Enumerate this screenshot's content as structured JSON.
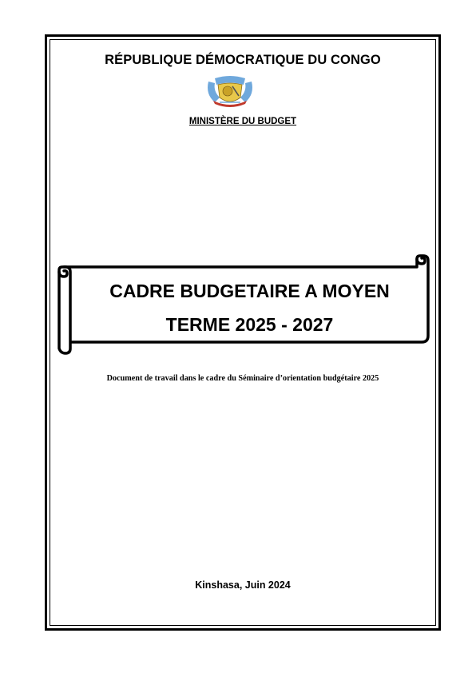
{
  "header": {
    "country": "RÉPUBLIQUE DÉMOCRATIQUE DU CONGO",
    "ministry": "MINISTÈRE DU BUDGET",
    "emblem_icon": "coat-of-arms-icon"
  },
  "main": {
    "title_line1": "CADRE BUDGETAIRE A MOYEN",
    "title_line2": "TERME 2025 - 2027",
    "subtitle": "Document de travail dans le cadre du Séminaire d’orientation budgétaire 2025"
  },
  "footer": {
    "place_date": "Kinshasa, Juin 2024"
  },
  "colors": {
    "emblem_blue": "#6fa8dc",
    "emblem_gold": "#e8c84a",
    "emblem_red": "#c0392b"
  }
}
